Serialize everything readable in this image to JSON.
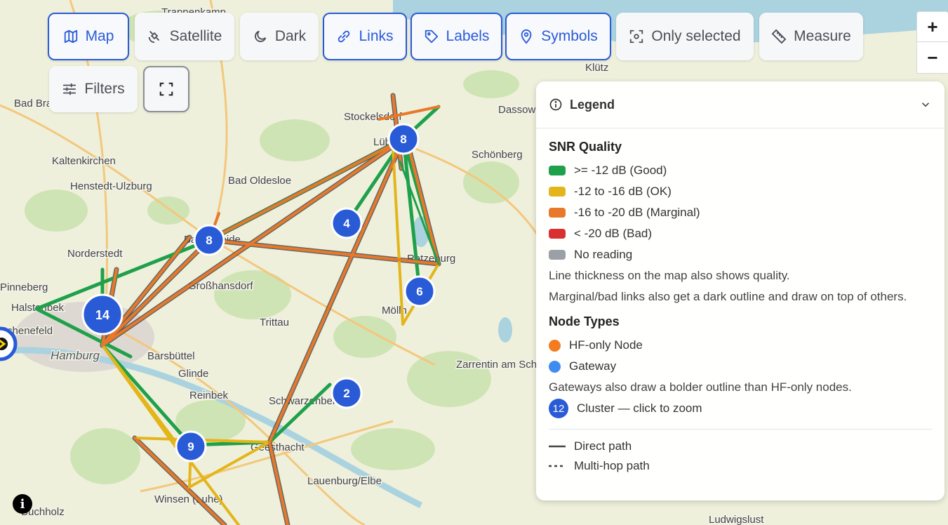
{
  "toolbar": {
    "map": "Map",
    "satellite": "Satellite",
    "dark": "Dark",
    "links": "Links",
    "labels": "Labels",
    "symbols": "Symbols",
    "only_selected": "Only selected",
    "measure": "Measure",
    "filters": "Filters"
  },
  "zoom": {
    "in": "+",
    "out": "−"
  },
  "colors": {
    "accent": "#2a5bd7",
    "good": "#1fa04a",
    "ok": "#e4b51b",
    "marginal": "#e8792a",
    "bad": "#d93030",
    "none": "#9aa0a6",
    "hf": "#f47b20",
    "gateway": "#3f8cf0"
  },
  "legend": {
    "title": "Legend",
    "snr_title": "SNR Quality",
    "snr_items": [
      {
        "label": ">= -12 dB (Good)",
        "color": "#1fa04a"
      },
      {
        "label": "-12 to -16 dB (OK)",
        "color": "#e4b51b"
      },
      {
        "label": "-16 to -20 dB (Marginal)",
        "color": "#e8792a"
      },
      {
        "label": "< -20 dB (Bad)",
        "color": "#d93030"
      },
      {
        "label": "No reading",
        "color": "#9aa0a6"
      }
    ],
    "note1": "Line thickness on the map also shows quality.",
    "note2": "Marginal/bad links also get a dark outline and draw on top of others.",
    "node_title": "Node Types",
    "node_items": [
      {
        "label": "HF-only Node",
        "color": "#f47b20"
      },
      {
        "label": "Gateway",
        "color": "#3f8cf0"
      }
    ],
    "note3": "Gateways also draw a bolder outline than HF-only nodes.",
    "cluster_badge": "12",
    "cluster_label": "Cluster — click to zoom",
    "direct": "Direct path",
    "multihop": "Multi-hop path"
  },
  "clusters": [
    {
      "count": "8"
    },
    {
      "count": "8"
    },
    {
      "count": "4"
    },
    {
      "count": "6"
    },
    {
      "count": "14"
    },
    {
      "count": "2"
    },
    {
      "count": "9"
    }
  ],
  "places": [
    "Trappenkamp",
    "Stockelsdorf",
    "Lübeck",
    "Dassow",
    "Klütz",
    "Schönberg",
    "Bad Oldesloe",
    "Kaltenkirchen",
    "Henstedt-Ulzburg",
    "Norderstedt",
    "Bargteheide",
    "Großhansdorf",
    "Ratzeburg",
    "Mölln",
    "Trittau",
    "Halstenbek",
    "Schenefeld",
    "Hamburg",
    "Barsbüttel",
    "Glinde",
    "Reinbek",
    "Schwarzenbek",
    "Zarrentin am Schaalsee",
    "Geesthacht",
    "Lauenburg/Elbe",
    "Winsen (Luhe)",
    "Buchholz",
    "Bad Bramstedt",
    "Pinneberg",
    "Ludwigslust"
  ],
  "info_label": "i"
}
